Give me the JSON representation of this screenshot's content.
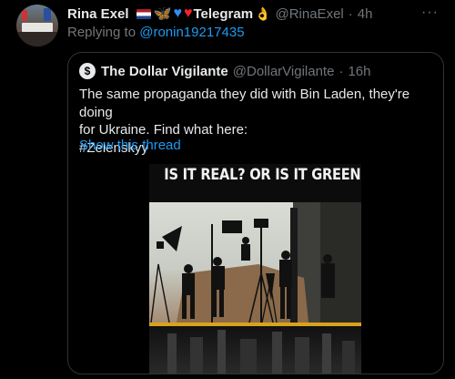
{
  "tweet": {
    "author_name": "Rina Exel",
    "telegram_text": "Telegram",
    "handle": "@RinaExel",
    "dot": "·",
    "time": "4h",
    "more_icon": "···",
    "replying_prefix": "Replying to",
    "replying_to": "@ronin19217435"
  },
  "quoted": {
    "avatar_letter": "$",
    "name": "The Dollar Vigilante",
    "handle": "@DollarVigilante",
    "dot": "·",
    "time": "16h",
    "text_lines": [
      "The same propaganda they did with Bin Laden, they're doing",
      "for Ukraine. Find what here:",
      "#Zelenskyy"
    ],
    "show_thread": "Show this thread",
    "media": {
      "title": "IS IT REAL? OR IS IT GREEN SCREEN?"
    }
  },
  "colors": {
    "background": "#000000",
    "text": "#e7e9ea",
    "secondary": "#71767b",
    "link": "#1d9bf0",
    "border": "#2f3336",
    "accent_stripe": "#d9a21b"
  }
}
